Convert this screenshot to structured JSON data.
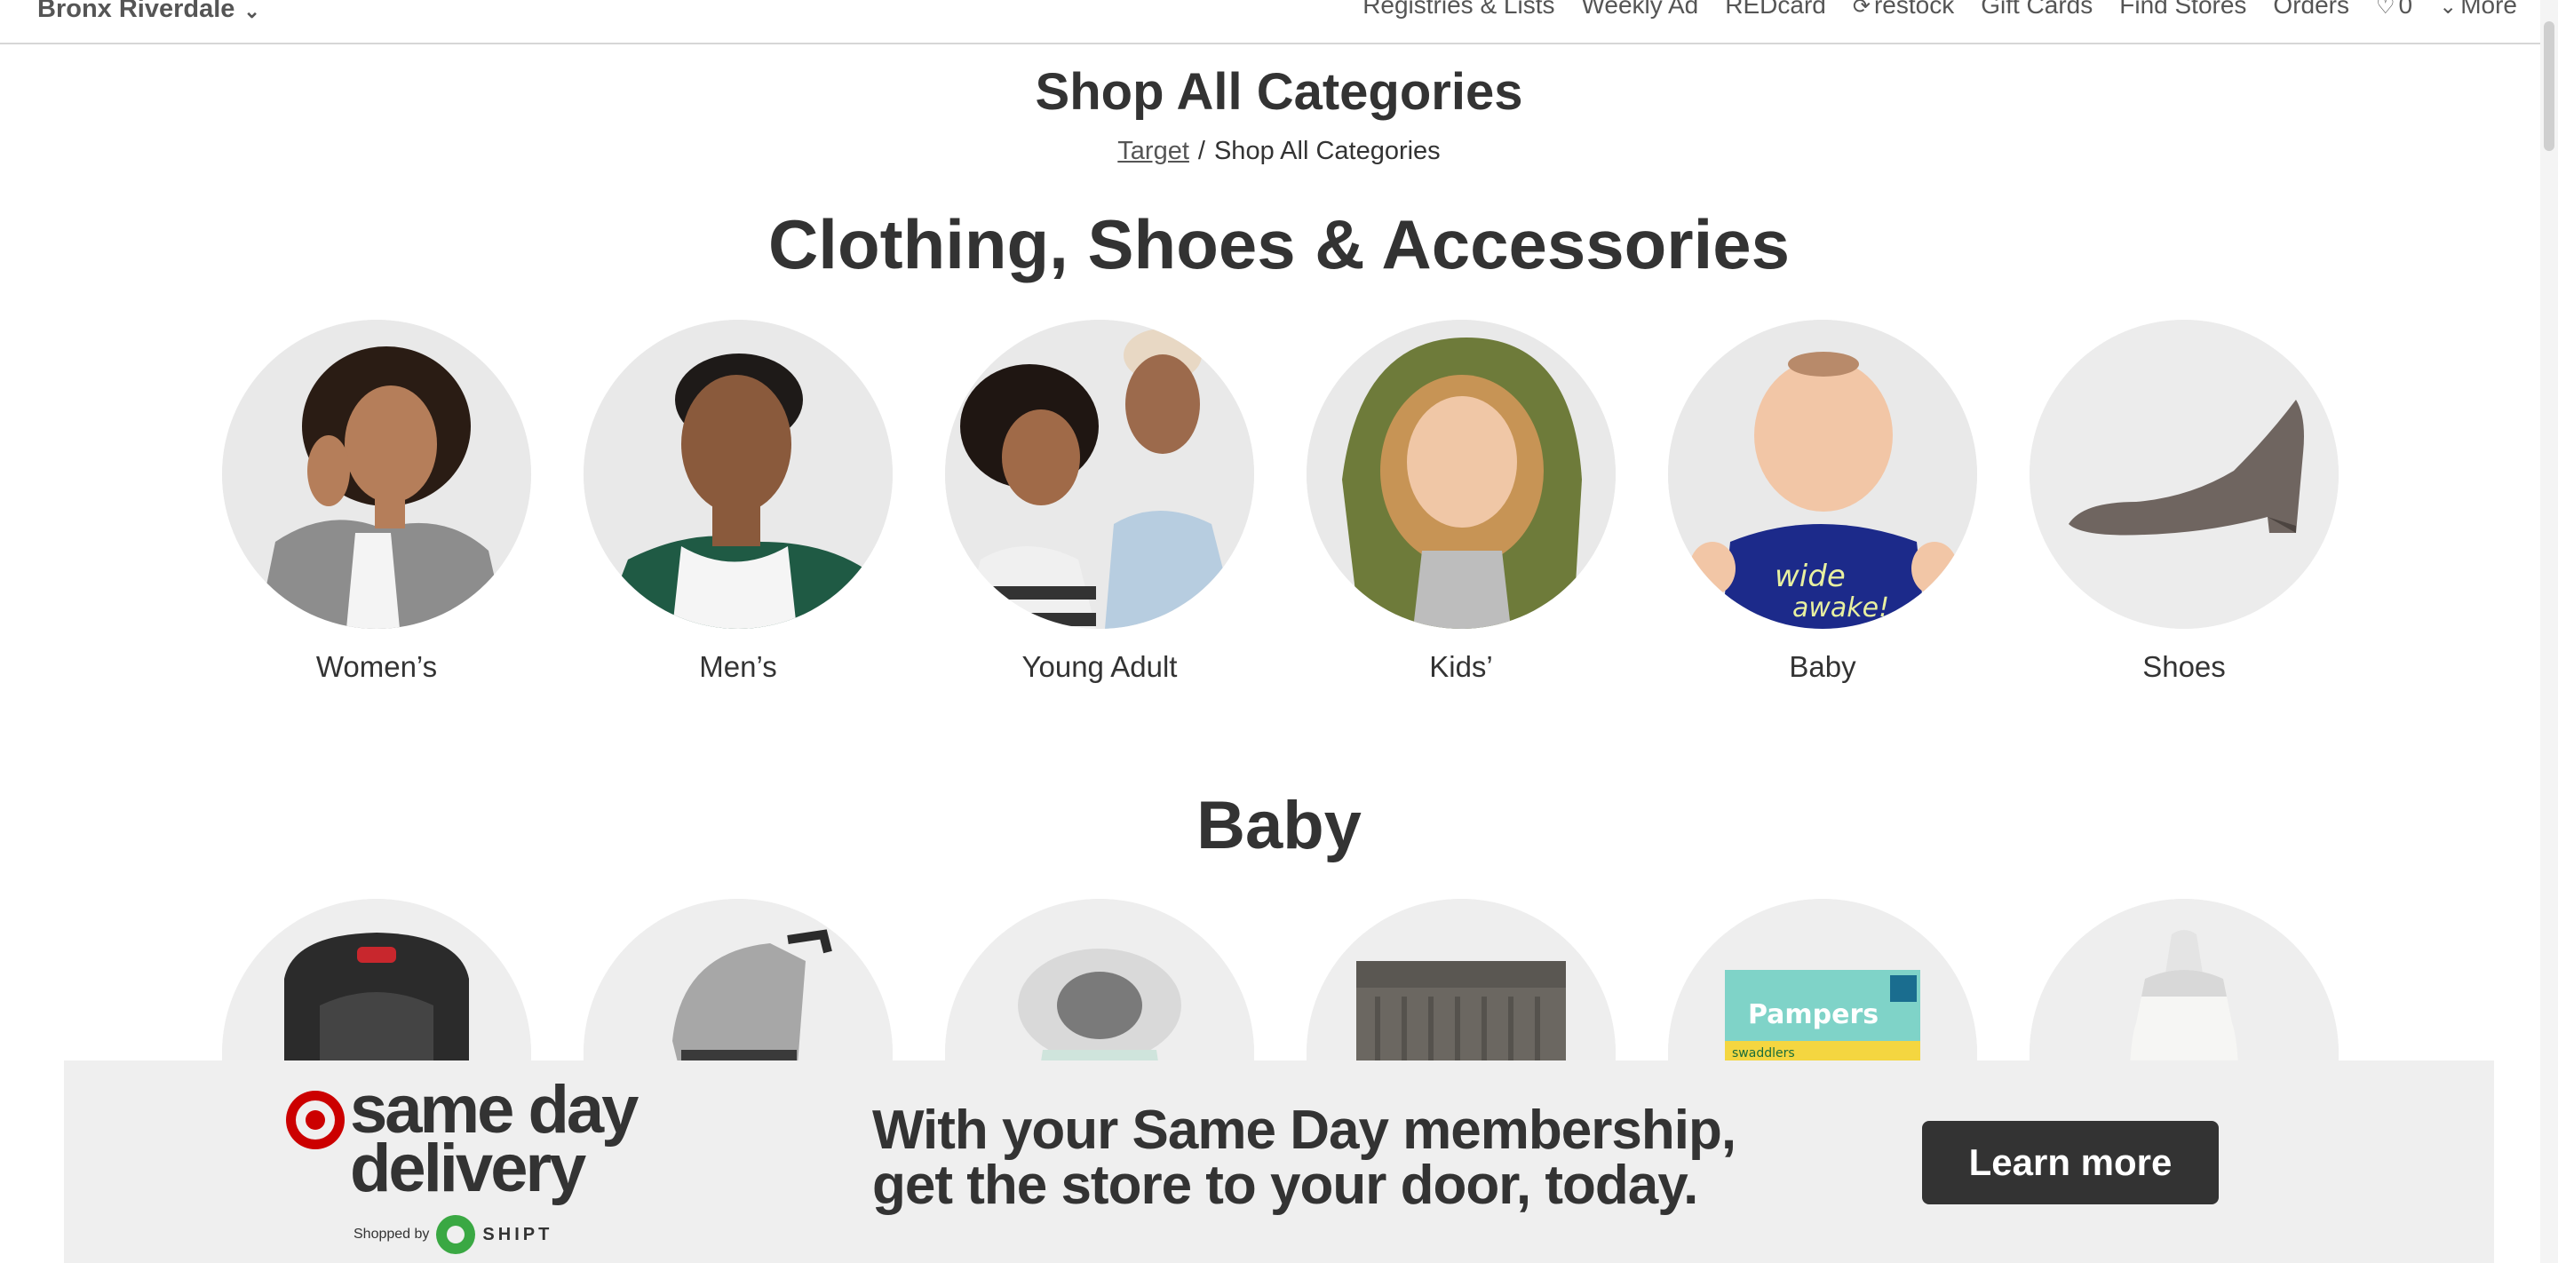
{
  "topbar": {
    "store_name": "Bronx Riverdale",
    "nav_items": [
      "Registries & Lists",
      "Weekly Ad",
      "REDcard",
      "restock",
      "Gift Cards",
      "Find Stores",
      "Orders",
      "0",
      "More"
    ]
  },
  "page": {
    "title": "Shop All Categories",
    "breadcrumb_root": "Target",
    "breadcrumb_separator": "/",
    "breadcrumb_current": "Shop All Categories"
  },
  "sections": [
    {
      "title": "Clothing, Shoes & Accessories",
      "categories": [
        {
          "label": "Women’s",
          "icon": "woman-portrait"
        },
        {
          "label": "Men’s",
          "icon": "man-portrait"
        },
        {
          "label": "Young Adult",
          "icon": "young-adults-portrait"
        },
        {
          "label": "Kids’",
          "icon": "kid-portrait"
        },
        {
          "label": "Baby",
          "icon": "baby-portrait"
        },
        {
          "label": "Shoes",
          "icon": "wedge-shoe"
        }
      ]
    },
    {
      "title": "Baby",
      "categories": [
        {
          "label": "",
          "icon": "car-seat"
        },
        {
          "label": "",
          "icon": "stroller"
        },
        {
          "label": "",
          "icon": "baby-bouncer"
        },
        {
          "label": "",
          "icon": "crib"
        },
        {
          "label": "",
          "icon": "diapers-box"
        },
        {
          "label": "",
          "icon": "baby-bottle"
        }
      ]
    }
  ],
  "banner": {
    "logo_line1": "same day",
    "logo_line2": "delivery",
    "shopped_by": "Shopped by",
    "shipt": "SHIPT",
    "message_line1": "With your Same Day membership,",
    "message_line2": "get the store to your door, today.",
    "cta": "Learn more",
    "diapers_brand": "Pampers",
    "diapers_sub": "swaddlers"
  },
  "colors": {
    "brand_red": "#cc0000",
    "shipt_green": "#3aa843",
    "banner_bg": "#efefef",
    "button_bg": "#333333"
  }
}
